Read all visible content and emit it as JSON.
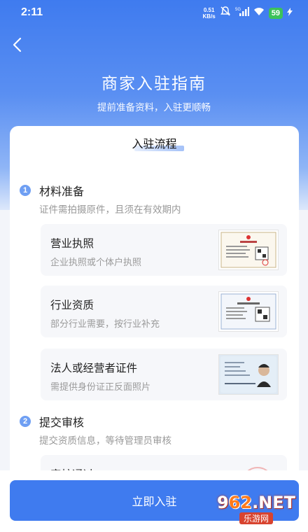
{
  "status_bar": {
    "time": "2:11",
    "net_speed_value": "0.51",
    "net_speed_unit": "KB/s",
    "network": "5G",
    "battery": "59"
  },
  "header": {
    "title": "商家入驻指南",
    "subtitle": "提前准备资料，入驻更顺畅"
  },
  "process": {
    "title": "入驻流程",
    "steps": [
      {
        "num": "1",
        "title": "材料准备",
        "desc": "证件需拍摄原件，且须在有效期内",
        "items": [
          {
            "name": "营业执照",
            "desc": "企业执照或个体户执照",
            "thumb": "business-license-image"
          },
          {
            "name": "行业资质",
            "desc": "部分行业需要，按行业补充",
            "thumb": "industry-permit-image"
          },
          {
            "name": "法人或经营者证件",
            "desc": "需提供身份证正反面照片",
            "thumb": "id-card-image"
          }
        ]
      },
      {
        "num": "2",
        "title": "提交审核",
        "desc": "提交资质信息，等待管理员审核",
        "items": [
          {
            "name": "审核通过",
            "desc": "",
            "thumb": "approved-stamp-image"
          }
        ]
      }
    ]
  },
  "cta": {
    "label": "立即入驻"
  },
  "watermark": {
    "main_a": "9",
    "main_num": "62",
    "main_b": ".NET",
    "sub": "乐游网"
  },
  "colors": {
    "primary": "#3f7bef",
    "step_badge": "#6f9ff3",
    "battery": "#3cc25a"
  }
}
